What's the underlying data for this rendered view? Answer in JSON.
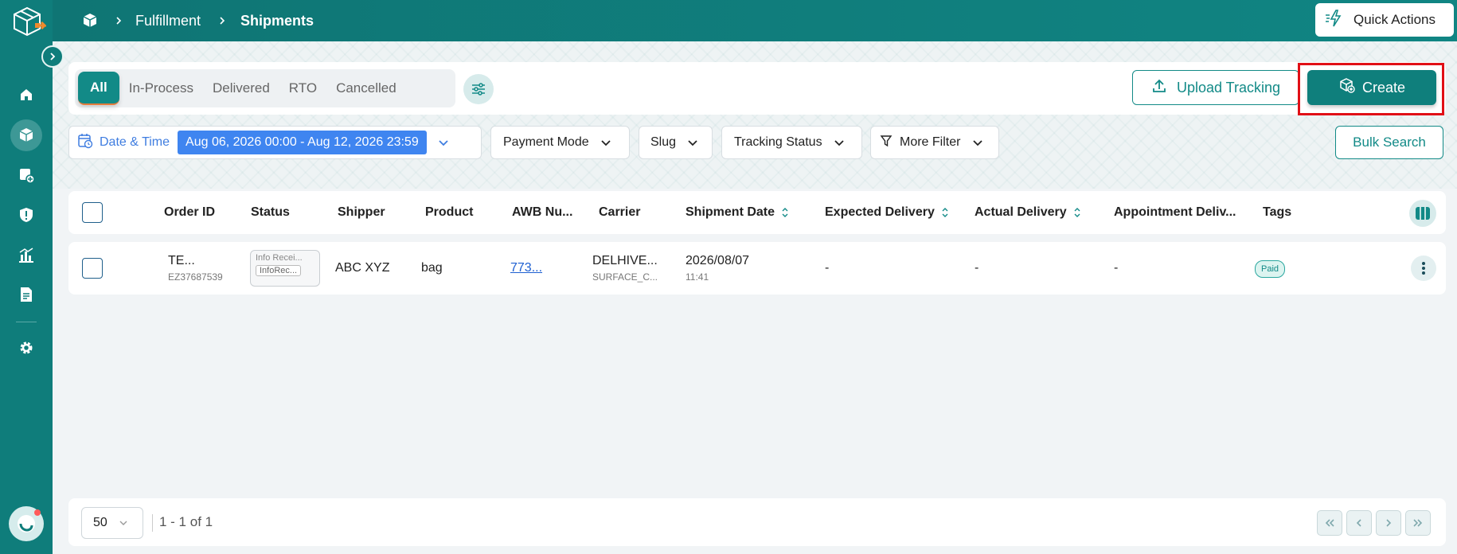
{
  "header": {
    "breadcrumbs": [
      "Fulfillment",
      "Shipments"
    ],
    "quick_actions_label": "Quick Actions"
  },
  "tabs": [
    {
      "label": "All",
      "active": true
    },
    {
      "label": "In-Process",
      "active": false
    },
    {
      "label": "Delivered",
      "active": false
    },
    {
      "label": "RTO",
      "active": false
    },
    {
      "label": "Cancelled",
      "active": false
    }
  ],
  "actions": {
    "upload_tracking": "Upload Tracking",
    "create": "Create",
    "bulk_search": "Bulk Search"
  },
  "filters": {
    "date_label": "Date & Time",
    "date_value": "Aug 06, 2026 00:00 - Aug 12, 2026 23:59",
    "payment_mode": "Payment Mode",
    "slug": "Slug",
    "tracking_status": "Tracking Status",
    "more_filter": "More Filter"
  },
  "table": {
    "columns": [
      "Order ID",
      "Status",
      "Shipper",
      "Product",
      "AWB Nu...",
      "Carrier",
      "Shipment Date",
      "Expected Delivery",
      "Actual Delivery",
      "Appointment Deliv...",
      "Tags"
    ],
    "rows": [
      {
        "order_id": "TE...",
        "order_sub": "EZ37687539",
        "status_1": "Info Recei...",
        "status_2": "InfoRec...",
        "shipper": "ABC XYZ",
        "product": "bag",
        "awb": "773...",
        "carrier": "DELHIVE...",
        "carrier_sub": "SURFACE_C...",
        "shipment_date": "2026/08/07",
        "shipment_time": "11:41",
        "expected_delivery": "-",
        "actual_delivery": "-",
        "appointment_delivery": "-",
        "tag": "Paid"
      }
    ]
  },
  "pagination": {
    "per_page": "50",
    "info": "1 - 1 of 1"
  },
  "colors": {
    "primary": "#0f7d7b",
    "accent_blue": "#3f85f0",
    "highlight_red": "#e10f16"
  }
}
